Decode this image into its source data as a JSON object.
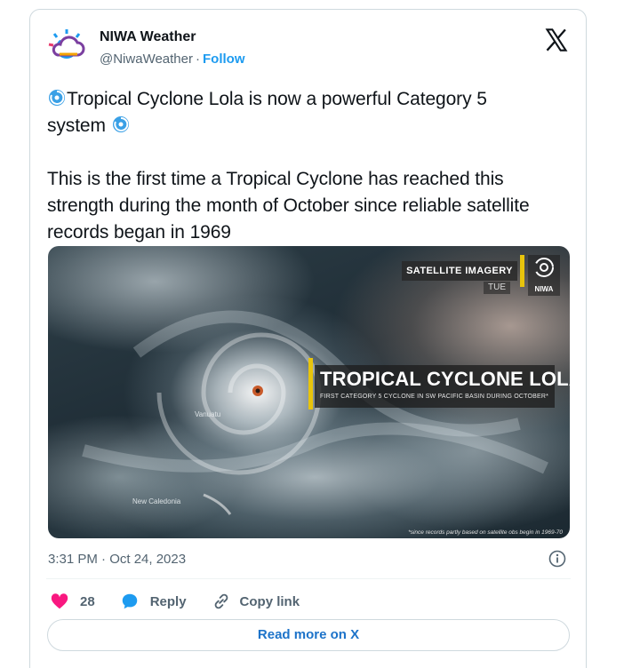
{
  "author": {
    "name": "NIWA Weather",
    "handle": "@NiwaWeather",
    "separator": "·",
    "follow_label": "Follow"
  },
  "tweet": {
    "line1": "Tropical Cyclone Lola is now a powerful Category 5",
    "line2": "system",
    "para2": "This is the first time a Tropical Cyclone has reached this strength during the month of October since reliable satellite records began in 1969"
  },
  "media": {
    "badge": "SATELLITE IMAGERY",
    "day": "TUE",
    "logo_text": "NIWA",
    "title": "TROPICAL CYCLONE LOLA",
    "subtitle": "FIRST CATEGORY 5 CYCLONE IN SW PACIFIC BASIN DURING OCTOBER*",
    "place_vanuatu": "Vanuatu",
    "place_new_caledonia": "New Caledonia",
    "footnote": "*since records partly based on satellite obs begin in 1969-70"
  },
  "meta": {
    "timestamp": "3:31 PM · Oct 24, 2023"
  },
  "actions": {
    "like_count": "28",
    "reply_label": "Reply",
    "copy_link_label": "Copy link"
  },
  "read_more_label": "Read more on X",
  "colors": {
    "accent": "#1d9bf0",
    "like": "#f91880",
    "text": "#0f1419",
    "muted": "#536471",
    "highlight_yellow": "#e8c40c"
  },
  "icons": {
    "cyclone": "cyclone-icon",
    "x_logo": "x-logo-icon",
    "info": "info-icon",
    "heart": "heart-icon",
    "reply": "speech-bubble-icon",
    "copy_link": "link-icon"
  }
}
